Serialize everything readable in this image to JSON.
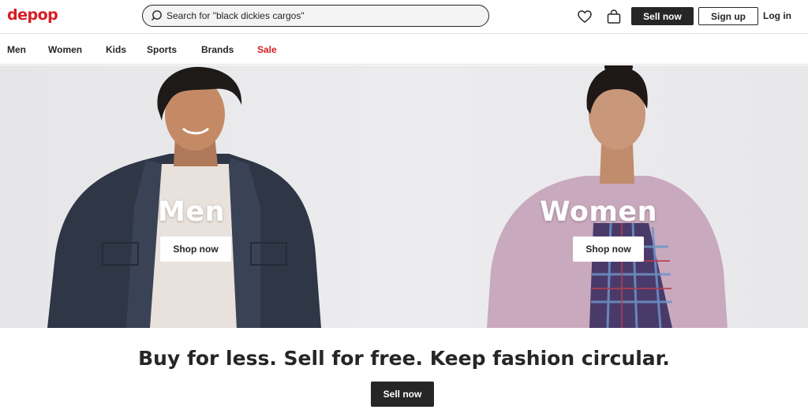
{
  "header": {
    "logo": "depop",
    "search": {
      "value": "",
      "placeholder": "Search for \"black dickies cargos\""
    },
    "sell_label": "Sell now",
    "signup_label": "Sign up",
    "login_label": "Log in"
  },
  "nav": {
    "items": [
      {
        "label": "Men"
      },
      {
        "label": "Women"
      },
      {
        "label": "Kids"
      },
      {
        "label": "Sports"
      },
      {
        "label": "Brands"
      },
      {
        "label": "Sale"
      }
    ]
  },
  "hero": {
    "men": {
      "title": "Men",
      "button": "Shop now"
    },
    "women": {
      "title": "Women",
      "button": "Shop now"
    }
  },
  "bottom": {
    "tagline": "Buy for less. Sell for free. Keep fashion circular.",
    "sell_label": "Sell now"
  },
  "colors": {
    "brand": "#d71c24",
    "dark": "#262626"
  }
}
